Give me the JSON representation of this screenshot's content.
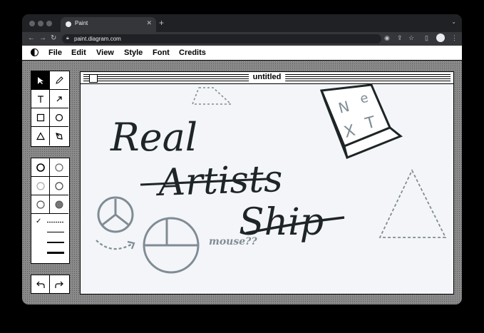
{
  "browser": {
    "tab_title": "Paint",
    "tab_close_icon": "close-icon",
    "new_tab_icon": "plus-icon",
    "url": "paint.diagram.com",
    "nav_icons": [
      "back-arrow-icon",
      "forward-arrow-icon",
      "reload-icon"
    ]
  },
  "menubar": {
    "items": [
      "File",
      "Edit",
      "View",
      "Style",
      "Font",
      "Credits"
    ]
  },
  "tools": [
    "select-arrow",
    "pencil",
    "text",
    "arrow-line",
    "rectangle",
    "ellipse",
    "triangle",
    "pen-nib"
  ],
  "selected_tool": "select-arrow",
  "canvas": {
    "title": "untitled",
    "drawing_text": {
      "line1": "Real",
      "line2": "Artists",
      "line3": "Ship",
      "note": "mouse??",
      "cube_letters": [
        "N",
        "e",
        "X",
        "T"
      ]
    }
  },
  "colors": {
    "ink": "#1e2526",
    "sketch_gray": "#7f8c95",
    "desktop_gray": "#8a8a8a"
  }
}
